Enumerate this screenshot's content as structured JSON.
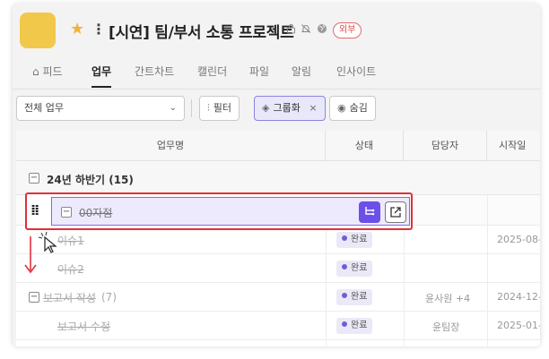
{
  "header": {
    "title": "[시연] 팀/부서 소통 프로젝트",
    "star_icon": "star-icon",
    "menu_icon": "more-vertical-icon",
    "lock_icon": "lock-icon",
    "bell_icon": "bell-off-icon",
    "globe_icon": "globe-icon",
    "external_badge": "외부"
  },
  "tabs": [
    {
      "label": "피드",
      "icon": "home-icon"
    },
    {
      "label": "업무",
      "active": true
    },
    {
      "label": "간트차트"
    },
    {
      "label": "캘린더"
    },
    {
      "label": "파일"
    },
    {
      "label": "알림"
    },
    {
      "label": "인사이트"
    }
  ],
  "toolbar": {
    "task_filter_value": "전체 업무",
    "filter_label": "필터",
    "group_label": "그룹화",
    "group_close": "×",
    "hide_label": "숨김"
  },
  "table": {
    "columns": [
      "업무명",
      "상태",
      "담당자",
      "시작일"
    ],
    "group": {
      "label": "24년 하반기 (15)"
    },
    "dragged_row": {
      "title": "00자점"
    },
    "rows": [
      {
        "title": "이슈1",
        "status": "완료",
        "assignee": "",
        "start": "2025-08-"
      },
      {
        "title": "이슈2",
        "status": "완료",
        "assignee": "",
        "start": ""
      },
      {
        "title": "보고서 작성",
        "count": "(7)",
        "status": "완료",
        "assignee": "윤사원 +4",
        "start": "2024-12-"
      },
      {
        "title": "보고서 수정",
        "status": "완료",
        "assignee": "윤팀장",
        "start": "2025-01-"
      }
    ]
  },
  "colors": {
    "accent": "#6b4fe8",
    "highlight": "#e0303a",
    "logo": "#f2c84b",
    "status_dot": "#6d5fd6"
  }
}
